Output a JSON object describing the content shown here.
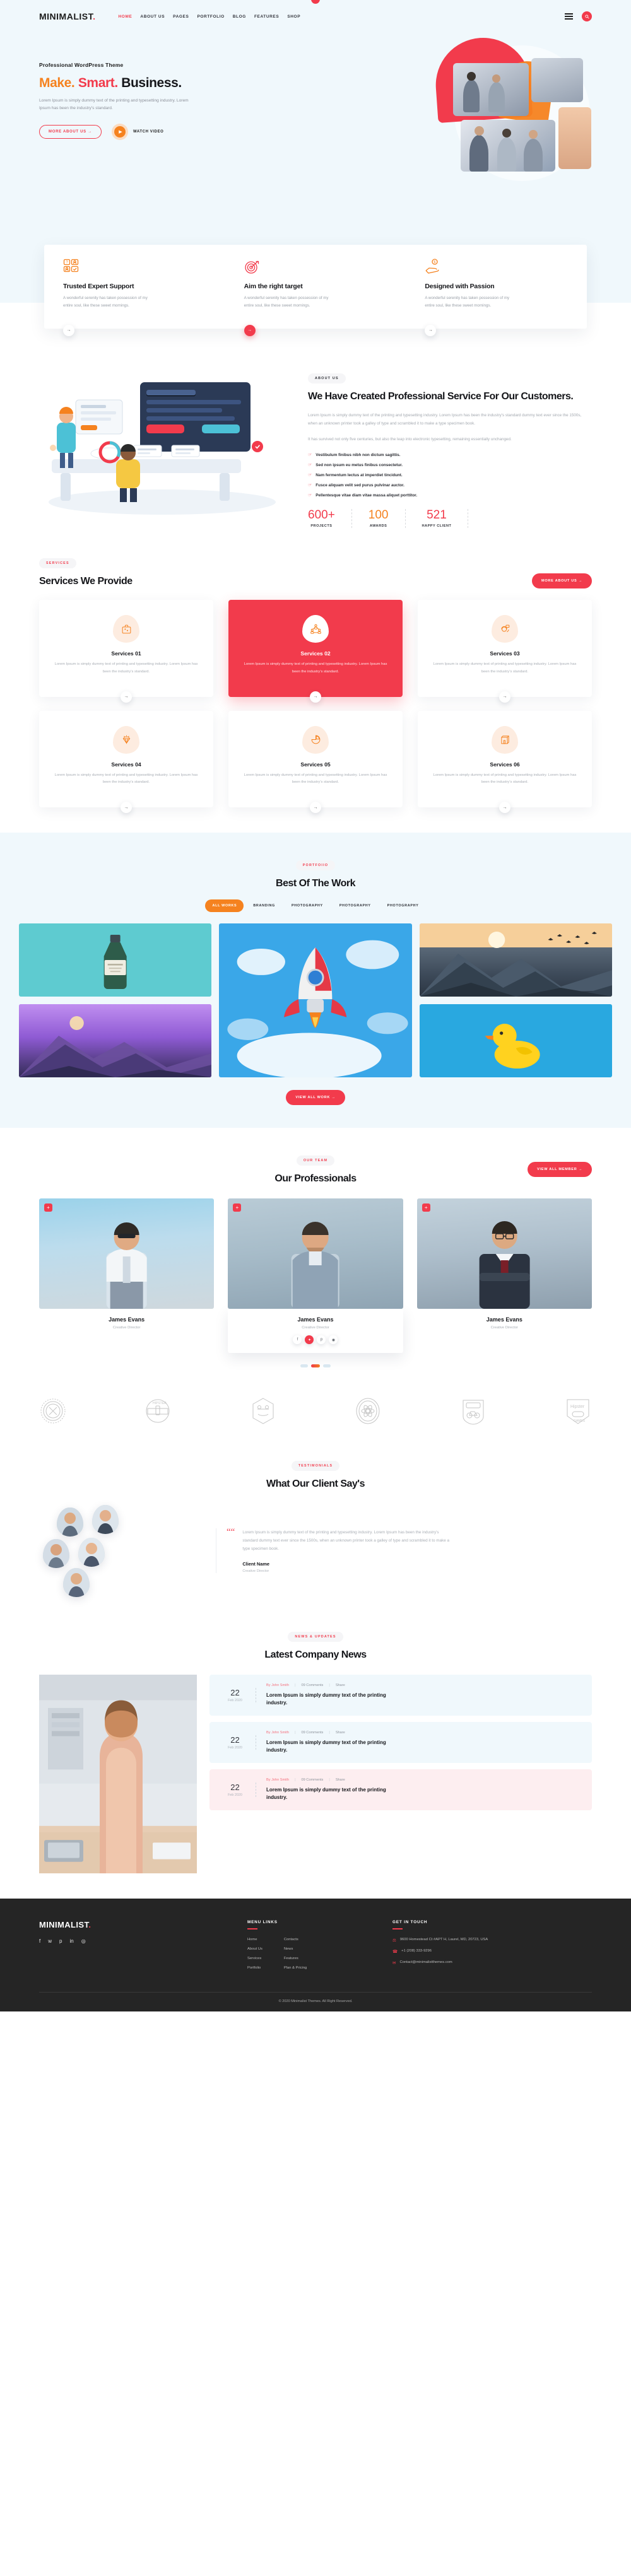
{
  "brand": {
    "name": "MINIMALIST",
    "dot": "."
  },
  "nav": {
    "items": [
      {
        "label": "HOME",
        "active": true
      },
      {
        "label": "ABOUT US",
        "active": false
      },
      {
        "label": "PAGES",
        "active": false
      },
      {
        "label": "PORTFOLIO",
        "active": false
      },
      {
        "label": "BLOG",
        "active": false
      },
      {
        "label": "FEATURES",
        "active": false
      },
      {
        "label": "SHOP",
        "active": false
      }
    ],
    "menu_icon": "hamburger-icon",
    "search_icon": "search-icon"
  },
  "hero": {
    "eyebrow": "Professional WordPress Theme",
    "title_parts": {
      "a": "Make.",
      "b": "Smart.",
      "c": "Business."
    },
    "paragraph": "Lorem Ipsum is simply dummy text of the printing and typesetting industry. Lorem Ipsum has been the industry's standard.",
    "primary_btn": "MORE ABOUT US →",
    "video_btn": "WATCH VIDEO",
    "play_icon": "play-icon"
  },
  "features": [
    {
      "icon": "support-team-icon",
      "title": "Trusted Expert Support",
      "text": "A wonderful serenity has taken possession of my entire soul, like these sweet mornings.",
      "arrow": "arrow-right-icon",
      "active": false
    },
    {
      "icon": "target-icon",
      "title": "Aim the right target",
      "text": "A wonderful serenity has taken possession of my entire soul, like these sweet mornings.",
      "arrow": "arrow-right-icon",
      "active": true
    },
    {
      "icon": "hand-coin-icon",
      "title": "Designed with Passion",
      "text": "A wonderful serenity has taken possession of my entire soul, like these sweet mornings.",
      "arrow": "arrow-right-icon",
      "active": false
    }
  ],
  "about": {
    "tag": "ABOUT US",
    "heading": "We Have Created Professional Service For Our Customers.",
    "p1": "Lorem Ipsum is simply dummy text of the printing and typesetting industry. Lorem Ipsum has been the industry's standard dummy text ever since the 1500s, when an unknown printer took a galley of type and scrambled it to make a type specimen book.",
    "p2": "It has survived not only five centuries, but also the leap into electronic typesetting, remaining essentially unchanged.",
    "checklist": [
      "Vestibulum finibus nibh non dictum sagittis.",
      "Sed non ipsum eu metus finibus consectetur.",
      "Nam fermentum lectus at imperdiet tincidunt.",
      "Fusce aliquam velit sed purus pulvinar auctor.",
      "Pellentesque vitae diam vitae massa aliquet porttitor."
    ],
    "counters": [
      {
        "value": "600+",
        "label": "PROJECTS",
        "color": "red"
      },
      {
        "value": "100",
        "label": "AWARDS",
        "color": "org"
      },
      {
        "value": "521",
        "label": "HAPPY CLIENT",
        "color": "red"
      }
    ]
  },
  "services": {
    "tag": "SERVICES",
    "heading": "Services We Provide",
    "cta": "MORE ABOUT US →",
    "cards": [
      {
        "icon": "briefcase-icon",
        "title": "Services 01",
        "text": "Lorem Ipsum is simply dummy text of printing and typesetting industry. Lorem Ipsum has been the industry's standard.",
        "active": false
      },
      {
        "icon": "network-users-icon",
        "title": "Services 02",
        "text": "Lorem Ipsum is simply dummy text of printing and typesetting industry. Lorem Ipsum has been the industry's standard.",
        "active": true
      },
      {
        "icon": "headset-support-icon",
        "title": "Services 03",
        "text": "Lorem Ipsum is simply dummy text of printing and typesetting industry. Lorem Ipsum has been the industry's standard.",
        "active": false
      },
      {
        "icon": "diamond-icon",
        "title": "Services 04",
        "text": "Lorem Ipsum is simply dummy text of printing and typesetting industry. Lorem Ipsum has been the industry's standard.",
        "active": false
      },
      {
        "icon": "pie-chart-icon",
        "title": "Services 05",
        "text": "Lorem Ipsum is simply dummy text of printing and typesetting industry. Lorem Ipsum has been the industry's standard.",
        "active": false
      },
      {
        "icon": "box-package-icon",
        "title": "Services 06",
        "text": "Lorem Ipsum is simply dummy text of printing and typesetting industry. Lorem Ipsum has been the industry's standard.",
        "active": false
      }
    ]
  },
  "portfolio": {
    "tag": "PORTFOIIO",
    "heading": "Best Of The Work",
    "filters": [
      {
        "label": "ALL WORKS",
        "active": true
      },
      {
        "label": "BRANDING",
        "active": false
      },
      {
        "label": "PHOTOGRAPHY",
        "active": false
      },
      {
        "label": "PHOTOGRAPHY",
        "active": false
      },
      {
        "label": "PHOTOGRAPHY",
        "active": false
      }
    ],
    "items": [
      {
        "name": "bottle-artwork"
      },
      {
        "name": "rocket-artwork"
      },
      {
        "name": "mountain-sunset-artwork"
      },
      {
        "name": "purple-mountain-artwork"
      },
      {
        "name": "rubber-duck-artwork"
      }
    ],
    "cta": "VIEW ALL WORK →"
  },
  "team": {
    "tag": "OUR TEAM",
    "heading": "Our Professionals",
    "cta": "VIEW ALL MEMBER →",
    "members": [
      {
        "name": "James Evans",
        "role": "Creative Director",
        "featured": false
      },
      {
        "name": "James Evans",
        "role": "Creative Director",
        "featured": true
      },
      {
        "name": "James Evans",
        "role": "Creative Director",
        "featured": false
      }
    ],
    "social": [
      "facebook-icon",
      "twitter-icon",
      "pinterest-icon",
      "instagram-icon"
    ],
    "dots": [
      false,
      true,
      false
    ]
  },
  "brands": [
    "hipster-outdoors-badge",
    "hipster-original-coffee-badge",
    "hipster-hexagon-badge",
    "atomic-hipster-badge",
    "hipster-motorbike-route-badge",
    "hipster-games-badge"
  ],
  "testimonials": {
    "tag": "TESTIMONIALS",
    "heading": "What Our Client Say's",
    "quote_icon": "quote-icon",
    "quote": "Lorem Ipsum is simply dummy text of the printing and typesetting industry. Lorem Ipsum has been the industry's standard dummy text ever since the 1500s, when an unknown printer took a galley of type and scrambled it to make a type specimen book.",
    "client_name": "Client Name",
    "client_role": "Creative Director",
    "avatars": [
      "avatar-1",
      "avatar-2",
      "avatar-3",
      "avatar-4",
      "avatar-5"
    ]
  },
  "news": {
    "tag": "NEWS & UPDATES",
    "heading": "Latest Company News",
    "image": "woman-at-desk-photo",
    "posts": [
      {
        "day": "22",
        "month": "Feb 2020",
        "by": "By John Smith",
        "comments": "09 Comments",
        "share": "Share",
        "title": "Lorem Ipsum is simply dummy text of the printing industry.",
        "tone": "blue"
      },
      {
        "day": "22",
        "month": "Feb 2020",
        "by": "By John Smith",
        "comments": "09 Comments",
        "share": "Share",
        "title": "Lorem Ipsum is simply dummy text of the printing industry.",
        "tone": "blue"
      },
      {
        "day": "22",
        "month": "Feb 2020",
        "by": "By John Smith",
        "comments": "09 Comments",
        "share": "Share",
        "title": "Lorem Ipsum is simply dummy text of the printing industry.",
        "tone": "pink"
      }
    ]
  },
  "footer": {
    "logo": "MINIMALIST",
    "social": [
      "facebook-icon",
      "twitter-icon",
      "pinterest-icon",
      "linkedin-icon",
      "instagram-icon"
    ],
    "menu_heading": "MENU LINKS",
    "links_col1": [
      "Home",
      "About Us",
      "Services",
      "Portfolio"
    ],
    "links_col2": [
      "Contacts",
      "News",
      "Features",
      "Plan & Pricing"
    ],
    "contact_heading": "GET IN TOUCH",
    "contact": [
      {
        "icon": "location-pin-icon",
        "text": "9600 Homestead Ct #APT H, Laurel, MD, 20723, USA"
      },
      {
        "icon": "phone-icon",
        "text": "+1 (208) 333-9296"
      },
      {
        "icon": "mail-icon",
        "text": "Contact@minimalistthemes.com"
      }
    ],
    "copyright_pre": "© 2020 Minimalist Themes. All Right Reserved.",
    "copyright_brand": "Minimalist Themes"
  },
  "colors": {
    "red": "#f23b4c",
    "orange": "#f5821f",
    "dark": "#15161a",
    "muted": "#a9aeb5",
    "tint": "#f0f8fc",
    "footer": "#252525"
  }
}
